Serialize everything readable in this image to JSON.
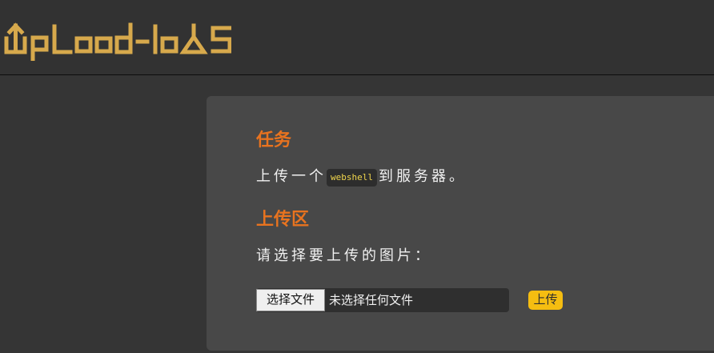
{
  "header": {
    "logo_text": "Upload-labS",
    "logo_color": "#d7a94c"
  },
  "task": {
    "title": "任务",
    "text_before": "上传一个",
    "code": "webshell",
    "text_after": "到服务器。"
  },
  "upload_section": {
    "title": "上传区",
    "prompt": "请选择要上传的图片：",
    "file_button_label": "选择文件",
    "file_status": "未选择任何文件",
    "submit_label": "上传"
  },
  "colors": {
    "page_background": "#353535",
    "card_background": "#484848",
    "section_heading": "#e8731f",
    "code_text": "#f0d54c",
    "submit_button": "#f5bd11"
  }
}
